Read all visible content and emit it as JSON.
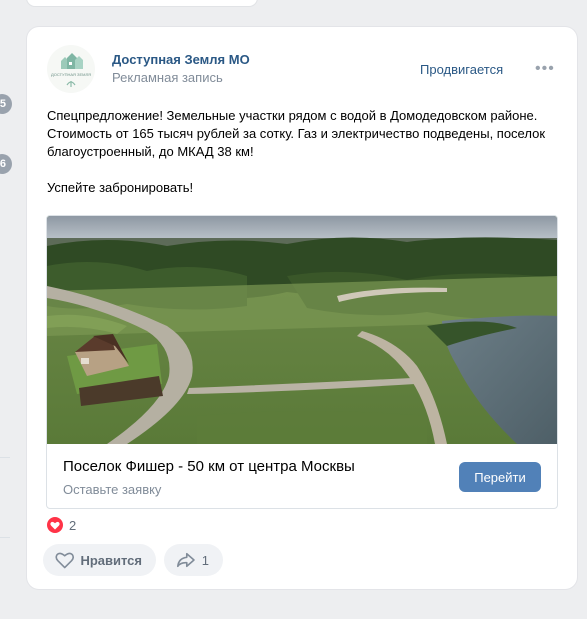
{
  "sidebar": {
    "badges": [
      "5",
      "6"
    ]
  },
  "post": {
    "author": "Доступная Земля МО",
    "subtitle": "Рекламная запись",
    "promoted": "Продвигается",
    "more": "•••",
    "avatar_text": "ДОСТУПНАЯ ЗЕМЛЯ",
    "text_lines": [
      "Спецпредложение! Земельные участки рядом с водой в Домодедовском районе.",
      "Стоимость от 165 тысяч рублей за сотку. Газ и электричество подведены, поселок",
      "благоустроенный, до МКАД 38 км!",
      "Успейте забронировать!"
    ]
  },
  "snippet": {
    "title": "Поселок Фишер - 50 км от центра Москвы",
    "subtitle": "Оставьте заявку",
    "button": "Перейти"
  },
  "reactions": {
    "likes_count": "2",
    "like_label": "Нравится",
    "share_count": "1"
  },
  "colors": {
    "link": "#2a5885",
    "button": "#5181b8",
    "muted": "#818c99",
    "heart": "#ff3347"
  }
}
